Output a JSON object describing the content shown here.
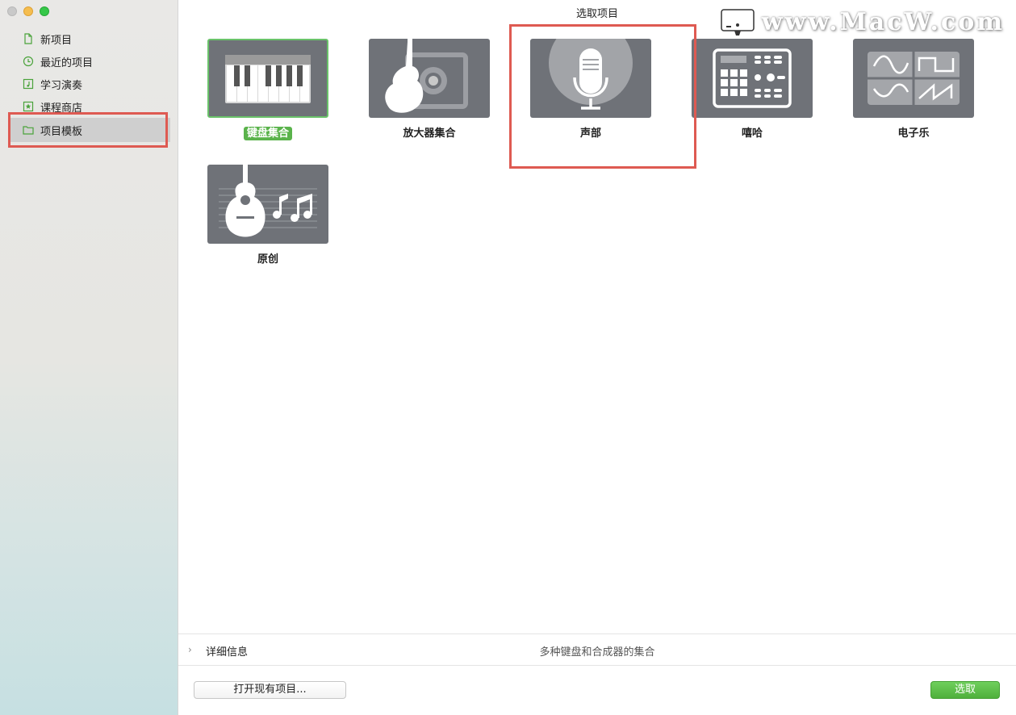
{
  "window": {
    "title": "选取项目"
  },
  "sidebar": {
    "items": [
      {
        "label": "新项目",
        "icon": "document-icon"
      },
      {
        "label": "最近的项目",
        "icon": "clock-icon"
      },
      {
        "label": "学习演奏",
        "icon": "music-note-icon"
      },
      {
        "label": "课程商店",
        "icon": "star-icon"
      },
      {
        "label": "项目模板",
        "icon": "folder-icon",
        "selected": true
      }
    ]
  },
  "templates": [
    {
      "label": "键盘集合",
      "icon": "piano-keyboard-icon",
      "selected": true
    },
    {
      "label": "放大器集合",
      "icon": "guitar-amp-icon"
    },
    {
      "label": "声部",
      "icon": "microphone-icon"
    },
    {
      "label": "嘻哈",
      "icon": "drum-machine-icon"
    },
    {
      "label": "电子乐",
      "icon": "waveform-icon"
    },
    {
      "label": "原创",
      "icon": "acoustic-guitar-notes-icon"
    }
  ],
  "details": {
    "label": "详细信息",
    "description": "多种键盘和合成器的集合"
  },
  "footer": {
    "open_label": "打开现有项目...",
    "choose_label": "选取"
  },
  "watermark": {
    "text": "www.MacW.com"
  },
  "colors": {
    "accent": "#5ab34b",
    "highlight": "#de5a52",
    "tile": "#6f7278"
  }
}
